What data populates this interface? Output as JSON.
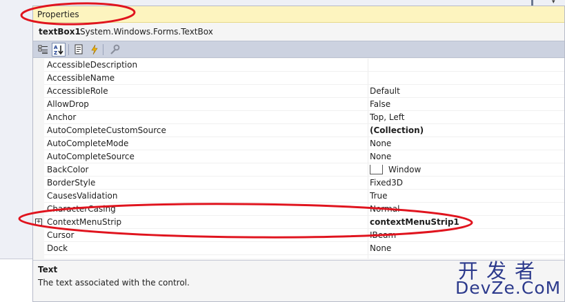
{
  "panel": {
    "title": "Properties",
    "object_name": "textBox1",
    "object_type": "System.Windows.Forms.TextBox"
  },
  "toolbar": {
    "buttons": [
      {
        "name": "categorized-icon"
      },
      {
        "name": "alphabetical-icon"
      },
      {
        "name": "properties-icon"
      },
      {
        "name": "events-icon"
      },
      {
        "name": "property-pages-icon"
      }
    ]
  },
  "grid": {
    "rows": [
      {
        "name": "AccessibleDescription",
        "value": ""
      },
      {
        "name": "AccessibleName",
        "value": ""
      },
      {
        "name": "AccessibleRole",
        "value": "Default"
      },
      {
        "name": "AllowDrop",
        "value": "False"
      },
      {
        "name": "Anchor",
        "value": "Top, Left"
      },
      {
        "name": "AutoCompleteCustomSource",
        "value": "(Collection)"
      },
      {
        "name": "AutoCompleteMode",
        "value": "None"
      },
      {
        "name": "AutoCompleteSource",
        "value": "None"
      },
      {
        "name": "BackColor",
        "value": "Window"
      },
      {
        "name": "BorderStyle",
        "value": "Fixed3D"
      },
      {
        "name": "CausesValidation",
        "value": "True"
      },
      {
        "name": "CharacterCasing",
        "value": "Normal"
      },
      {
        "name": "ContextMenuStrip",
        "value": "contextMenuStrip1"
      },
      {
        "name": "Cursor",
        "value": "IBeam"
      },
      {
        "name": "Dock",
        "value": "None"
      }
    ],
    "expander_symbol": "+"
  },
  "description": {
    "title": "Text",
    "text": "The text associated with the control."
  },
  "watermark": {
    "cn": "开发者",
    "en": "DevZe.CoM"
  },
  "colors": {
    "title_bg": "#fdf4bf",
    "toolbar_bg": "#ccd2e0",
    "annotation": "#e0141e",
    "watermark": "#2c3a8c"
  }
}
